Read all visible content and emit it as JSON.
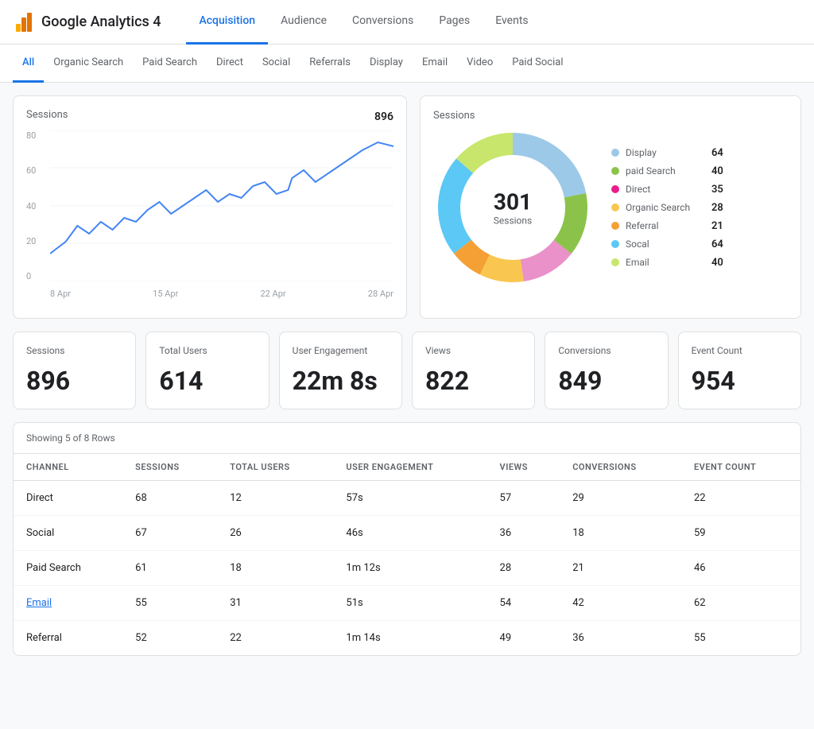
{
  "app": {
    "logo_text": "Google Analytics 4",
    "main_nav": [
      {
        "label": "Acquisition",
        "active": true
      },
      {
        "label": "Audience",
        "active": false
      },
      {
        "label": "Conversions",
        "active": false
      },
      {
        "label": "Pages",
        "active": false
      },
      {
        "label": "Events",
        "active": false
      }
    ],
    "sub_nav": [
      {
        "label": "All",
        "active": true
      },
      {
        "label": "Organic Search",
        "active": false
      },
      {
        "label": "Paid Search",
        "active": false
      },
      {
        "label": "Direct",
        "active": false
      },
      {
        "label": "Social",
        "active": false
      },
      {
        "label": "Referrals",
        "active": false
      },
      {
        "label": "Display",
        "active": false
      },
      {
        "label": "Email",
        "active": false
      },
      {
        "label": "Video",
        "active": false
      },
      {
        "label": "Paid Social",
        "active": false
      }
    ]
  },
  "line_chart": {
    "title": "Sessions",
    "total": "896",
    "y_labels": [
      "80",
      "60",
      "40",
      "20",
      "0"
    ],
    "x_labels": [
      "8 Apr",
      "15 Apr",
      "22 Apr",
      "28 Apr"
    ]
  },
  "donut_chart": {
    "title": "Sessions",
    "center_value": "301",
    "center_label": "Sessions",
    "legend": [
      {
        "name": "Display",
        "value": "64",
        "color": "#9cc9e8"
      },
      {
        "name": "paid Search",
        "value": "40",
        "color": "#8bc34a"
      },
      {
        "name": "Direct",
        "value": "35",
        "color": "#e91e8c"
      },
      {
        "name": "Organic Search",
        "value": "28",
        "color": "#f9c74f"
      },
      {
        "name": "Referral",
        "value": "21",
        "color": "#f4a035"
      },
      {
        "name": "Socal",
        "value": "64",
        "color": "#5bc8f5"
      },
      {
        "name": "Email",
        "value": "40",
        "color": "#c8e66c"
      }
    ]
  },
  "metrics": [
    {
      "label": "Sessions",
      "value": "896"
    },
    {
      "label": "Total Users",
      "value": "614"
    },
    {
      "label": "User Engagement",
      "value": "22m 8s"
    },
    {
      "label": "Views",
      "value": "822"
    },
    {
      "label": "Conversions",
      "value": "849"
    },
    {
      "label": "Event Count",
      "value": "954"
    }
  ],
  "table": {
    "info": "Showing 5 of 8 Rows",
    "columns": [
      "CHANNEL",
      "SESSIONS",
      "TOTAL USERS",
      "USER ENGAGEMENT",
      "VIEWS",
      "CONVERSIONS",
      "EVENT COUNT"
    ],
    "rows": [
      {
        "channel": "Direct",
        "link": false,
        "sessions": "68",
        "total_users": "12",
        "user_engagement": "57s",
        "views": "57",
        "conversions": "29",
        "event_count": "22"
      },
      {
        "channel": "Social",
        "link": false,
        "sessions": "67",
        "total_users": "26",
        "user_engagement": "46s",
        "views": "36",
        "conversions": "18",
        "event_count": "59"
      },
      {
        "channel": "Paid Search",
        "link": false,
        "sessions": "61",
        "total_users": "18",
        "user_engagement": "1m 12s",
        "views": "28",
        "conversions": "21",
        "event_count": "46"
      },
      {
        "channel": "Email",
        "link": true,
        "sessions": "55",
        "total_users": "31",
        "user_engagement": "51s",
        "views": "54",
        "conversions": "42",
        "event_count": "62"
      },
      {
        "channel": "Referral",
        "link": false,
        "sessions": "52",
        "total_users": "22",
        "user_engagement": "1m 14s",
        "views": "49",
        "conversions": "36",
        "event_count": "55"
      }
    ]
  }
}
